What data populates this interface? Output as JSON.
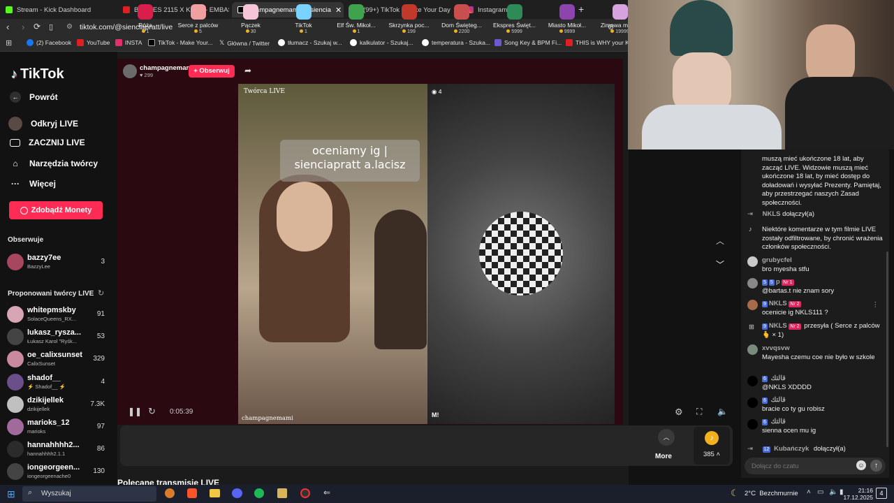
{
  "browser": {
    "tabs": [
      {
        "title": "Stream - Kick Dashboard",
        "color": "#53fc18"
      },
      {
        "title": "BEDOES 2115 X KILLY - EMBASSY / A",
        "color": "#e02020"
      },
      {
        "title": "champagnemami (@sienciap",
        "color": "#ffffff"
      },
      {
        "title": "(99+) TikTok - Make Your Day",
        "color": "#ffffff"
      },
      {
        "title": "Instagram",
        "color": "#e1306c"
      }
    ],
    "new_tab": "+",
    "address": "tiktok.com/@sienciapratt/live",
    "bookmarks": [
      "(2) Facebook",
      "YouTube",
      "INSTA",
      "TikTok - Make Your...",
      "Główna / Twitter",
      "tłumacz - Szukaj w...",
      "kalkulator - Szukaj...",
      "temperatura - Szuka...",
      "Song Key & BPM Fi...",
      "THIS is WHY your Kl..."
    ]
  },
  "sidebar": {
    "logo": "TikTok",
    "back": "Powrót",
    "nav": [
      "Odkryj LIVE",
      "ZACZNIJ LIVE",
      "Narzędzia twórcy",
      "Więcej"
    ],
    "coins_button": "Zdobądź Monety",
    "following_title": "Obserwuje",
    "following": [
      {
        "name": "bazzy7ee",
        "sub": "BazzyLee",
        "count": "3"
      }
    ],
    "suggested_title": "Proponowani twórcy LIVE",
    "suggested": [
      {
        "name": "whitepmskby",
        "sub": "SolaceQueens_RX...",
        "count": "91"
      },
      {
        "name": "lukasz_rysza...",
        "sub": "Łukasz Karol \"Ryśk...",
        "count": "53"
      },
      {
        "name": "oe_calixsunset",
        "sub": "CalixSunset",
        "count": "329"
      },
      {
        "name": "shadof__",
        "sub": "⚡ Shadof__ ⚡",
        "count": "4"
      },
      {
        "name": "dzikijellek",
        "sub": "dzikijellek",
        "count": "7.3K"
      },
      {
        "name": "marioks_12",
        "sub": "marioks",
        "count": "97"
      },
      {
        "name": "hannahhhh2...",
        "sub": "hannahhhh2.1.1",
        "count": "86"
      },
      {
        "name": "iongeorgeen...",
        "sub": "iongeorgeenache0",
        "count": "130"
      }
    ]
  },
  "stream": {
    "host": "champagnemami",
    "likes": "299",
    "follow": "+ Obserwuj",
    "creator_label": "Twórca LIVE",
    "viewers": "4",
    "overlay_text": "oceniamy ig | sienciapratt a.lacisz",
    "timer": "0:05:39",
    "watermark": "champagnemami",
    "recommended": "Polecane transmisje LIVE"
  },
  "gifts": [
    {
      "name": "Róża",
      "price": "1",
      "color": "#d81e4a"
    },
    {
      "name": "Serce z palców",
      "price": "5",
      "color": "#f0a0a0"
    },
    {
      "name": "Pączek",
      "price": "30",
      "color": "#f6c6d8"
    },
    {
      "name": "TikTok",
      "price": "1",
      "color": "#7ad3ff"
    },
    {
      "name": "Elf Św. Mikoł...",
      "price": "1",
      "color": "#3fa34d"
    },
    {
      "name": "Skrzynka poc...",
      "price": "199",
      "color": "#c0392b"
    },
    {
      "name": "Dom Święteg...",
      "price": "2200",
      "color": "#c94f4f"
    },
    {
      "name": "Ekspres Święt...",
      "price": "5999",
      "color": "#2e8b57"
    },
    {
      "name": "Miasto Mikoł...",
      "price": "9999",
      "color": "#8e44ad"
    },
    {
      "name": "Zimowa magia",
      "price": "19999",
      "color": "#d6a3e0"
    }
  ],
  "gift_more": "More",
  "coins_balance": "385",
  "chat": {
    "messages": [
      {
        "user": "",
        "text": "muszą mieć ukończone 18 lat, aby zacząć LIVE. Widzowie muszą mieć ukończone 18 lat, by mieć dostęp do doładowań i wysyłać Prezenty. Pamiętaj, aby przestrzegać naszych Zasad społeczności."
      },
      {
        "user": "NKLS",
        "text": "dołączył(a)"
      },
      {
        "user": "",
        "text": "Niektóre komentarze w tym filmie LIVE zostały odfiltrowane, by chronić wrażenia członków społeczności."
      },
      {
        "user": "grubycfel",
        "text": "bro myesha stfu"
      },
      {
        "user": "p",
        "text": "@bartas.t nie znam sory"
      },
      {
        "user": "NKLS",
        "text": "ocenicie ig NKLS111 ?"
      },
      {
        "user": "NKLS",
        "text": "przesyła ( Serce z palców 🫰 × 1)"
      },
      {
        "user": "xvvqsvw",
        "text": "Mayesha czemu coe nie było w szkole"
      },
      {
        "user": "قالتك",
        "text": "@NKLS XDDDD"
      },
      {
        "user": "قالتك",
        "text": "bracie co ty gu robisz"
      },
      {
        "user": "قالتك",
        "text": "sienna ocen mu ig"
      },
      {
        "user": "Kubańczyk",
        "text": "dołączył(a)"
      }
    ],
    "badges": [
      "5",
      "5",
      "Nr 1",
      "9",
      "Nr 2",
      "9",
      "Nr 2",
      "6",
      "6",
      "6",
      "12"
    ],
    "input_placeholder": "Dołącz do czatu"
  },
  "taskbar": {
    "search": "Wyszukaj",
    "weather": "2°C  Bezchmurnie",
    "time": "21:16",
    "date": "17.12.2025",
    "notifications": "4"
  }
}
